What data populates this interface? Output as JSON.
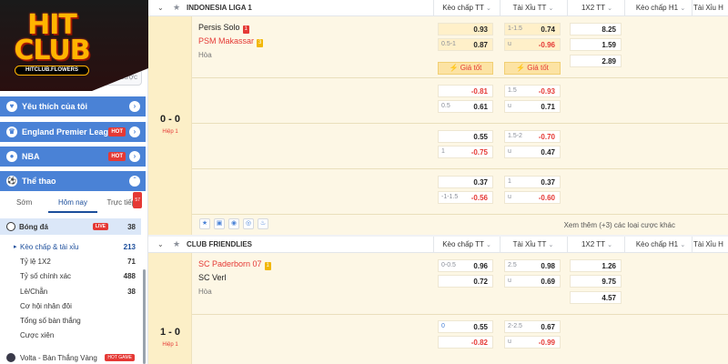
{
  "logo": {
    "title": "HIT CLUB",
    "subtitle": "HITCLUB.FLOWERS"
  },
  "search": {
    "placeholder": "ảng cược"
  },
  "sidebar": {
    "nav": [
      {
        "label": "Yêu thích của tôi",
        "icon": "heart-icon"
      },
      {
        "label": "England Premier League",
        "icon": "trophy-icon",
        "badge": "HOT"
      },
      {
        "label": "NBA",
        "icon": "basketball-icon",
        "badge": "HOT"
      },
      {
        "label": "Thể thao",
        "icon": "sports-icon"
      }
    ],
    "tabs": [
      {
        "label": "Sớm"
      },
      {
        "label": "Hôm nay"
      },
      {
        "label": "Trực tiếp",
        "badge": "57"
      }
    ],
    "sport": {
      "label": "Bóng đá",
      "live": "LIVE",
      "count": "38"
    },
    "markets": [
      {
        "label": "Kèo chấp & tài xỉu",
        "count": "213"
      },
      {
        "label": "Tỷ lệ 1X2",
        "count": "71"
      },
      {
        "label": "Tỷ số chính xác",
        "count": "488"
      },
      {
        "label": "Lẻ/Chẵn",
        "count": "38"
      },
      {
        "label": "Cơ hội nhân đôi",
        "count": ""
      },
      {
        "label": "Tổng số bàn thắng",
        "count": ""
      },
      {
        "label": "Cược xiên",
        "count": ""
      }
    ],
    "volta": {
      "label": "Volta - Bàn Thắng Vàng",
      "badge": "HOT GAME"
    }
  },
  "columns": [
    "Kèo chấp TT",
    "Tài Xỉu TT",
    "1X2 TT",
    "Kèo chấp H1",
    "Tài Xỉu H"
  ],
  "leagues": [
    {
      "name": "INDONESIA LIGA 1",
      "match": {
        "score": "0 - 0",
        "period": "Hiệp 1",
        "home": "Persis Solo",
        "home_tag": "1",
        "away": "PSM Makassar",
        "away_tag": "3",
        "draw": "Hòa",
        "best_label": "Giá tốt",
        "rows": [
          {
            "hdp": [
              "",
              "0.93",
              "0.5-1",
              "0.87"
            ],
            "ou": [
              "1-1.5",
              "0.74",
              "u",
              "-0.96"
            ],
            "x12": [
              "8.25",
              "1.59",
              "2.89"
            ]
          },
          {
            "hdp": [
              "",
              "-0.81",
              "0.5",
              "0.61"
            ],
            "ou": [
              "1.5",
              "-0.93",
              "u",
              "0.71"
            ]
          },
          {
            "hdp": [
              "",
              "0.55",
              "1",
              "-0.75"
            ],
            "ou": [
              "1.5-2",
              "-0.70",
              "u",
              "0.47"
            ]
          },
          {
            "hdp": [
              "",
              "0.37",
              "-1-1.5",
              "-0.56"
            ],
            "ou": [
              "1",
              "0.37",
              "u",
              "-0.60"
            ]
          }
        ],
        "more": "Xem thêm (+3) các loại cược khác"
      }
    },
    {
      "name": "CLUB FRIENDLIES",
      "match": {
        "score": "1 - 0",
        "period": "Hiệp 1",
        "home": "SC Paderborn 07",
        "home_tag": "1",
        "away": "SC Verl",
        "away_tag": "",
        "draw": "Hòa",
        "rows": [
          {
            "hdp": [
              "0-0.5",
              "0.96",
              "",
              "0.72"
            ],
            "ou": [
              "2.5",
              "0.98",
              "u",
              "0.69"
            ],
            "x12": [
              "1.26",
              "9.75",
              "4.57"
            ]
          },
          {
            "hdp": [
              "0",
              "0.55",
              "",
              "-0.82"
            ],
            "ou": [
              "2-2.5",
              "0.67",
              "u",
              "-0.99"
            ]
          }
        ]
      }
    }
  ]
}
